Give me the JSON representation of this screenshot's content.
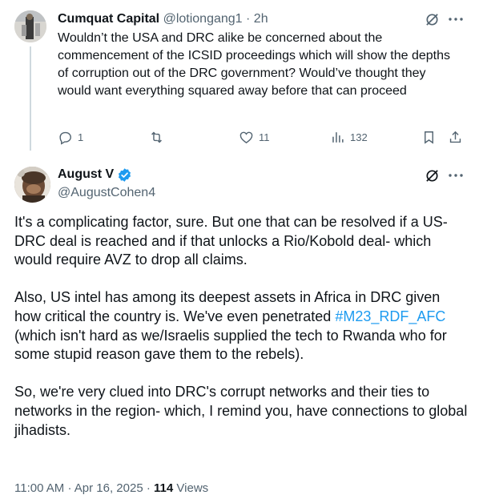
{
  "reply": {
    "author_name": "Cumquat Capital",
    "author_handle": "@lotiongang1",
    "separator": "·",
    "time": "2h",
    "text": "Wouldn’t the USA and DRC alike be concerned about the commencement of the ICSID proceedings which will show the depths of corruption out of the DRC government? Would’ve thought they would want everything squared away before that can proceed",
    "actions": {
      "replies": "1",
      "reposts": "",
      "likes": "11",
      "views": "132"
    }
  },
  "main": {
    "author_name": "August V",
    "author_handle": "@AugustCohen4",
    "verified": true,
    "paragraphs": [
      "It's a complicating factor, sure. But one that can be resolved if a US-DRC deal is reached and if that unlocks a Rio/Kobold deal- which would require AVZ to drop all claims.",
      "So, we're very clued into DRC's corrupt networks and their ties to networks in the region- which, I remind you, have connections to global jihadists."
    ],
    "paragraph2": {
      "before": "Also, US intel has among its deepest assets in Africa in DRC given how critical the country is.  We've even penetrated ",
      "hashtag": "#M23_RDF_AFC",
      "after": " (which isn't hard as we/Israelis supplied the tech to Rwanda who for some stupid reason gave them to the rebels)."
    },
    "footer": {
      "time": "11:00 AM",
      "sep1": "·",
      "date": "Apr 16, 2025",
      "sep2": "·",
      "views_count": "114",
      "views_label": "Views"
    }
  },
  "colors": {
    "text": "#0f1419",
    "secondary": "#536471",
    "accent": "#1d9bf0"
  },
  "icons": [
    "grok-icon",
    "more-icon",
    "reply-icon",
    "repost-icon",
    "like-icon",
    "views-icon",
    "bookmark-icon",
    "share-icon",
    "verified-badge-icon"
  ]
}
